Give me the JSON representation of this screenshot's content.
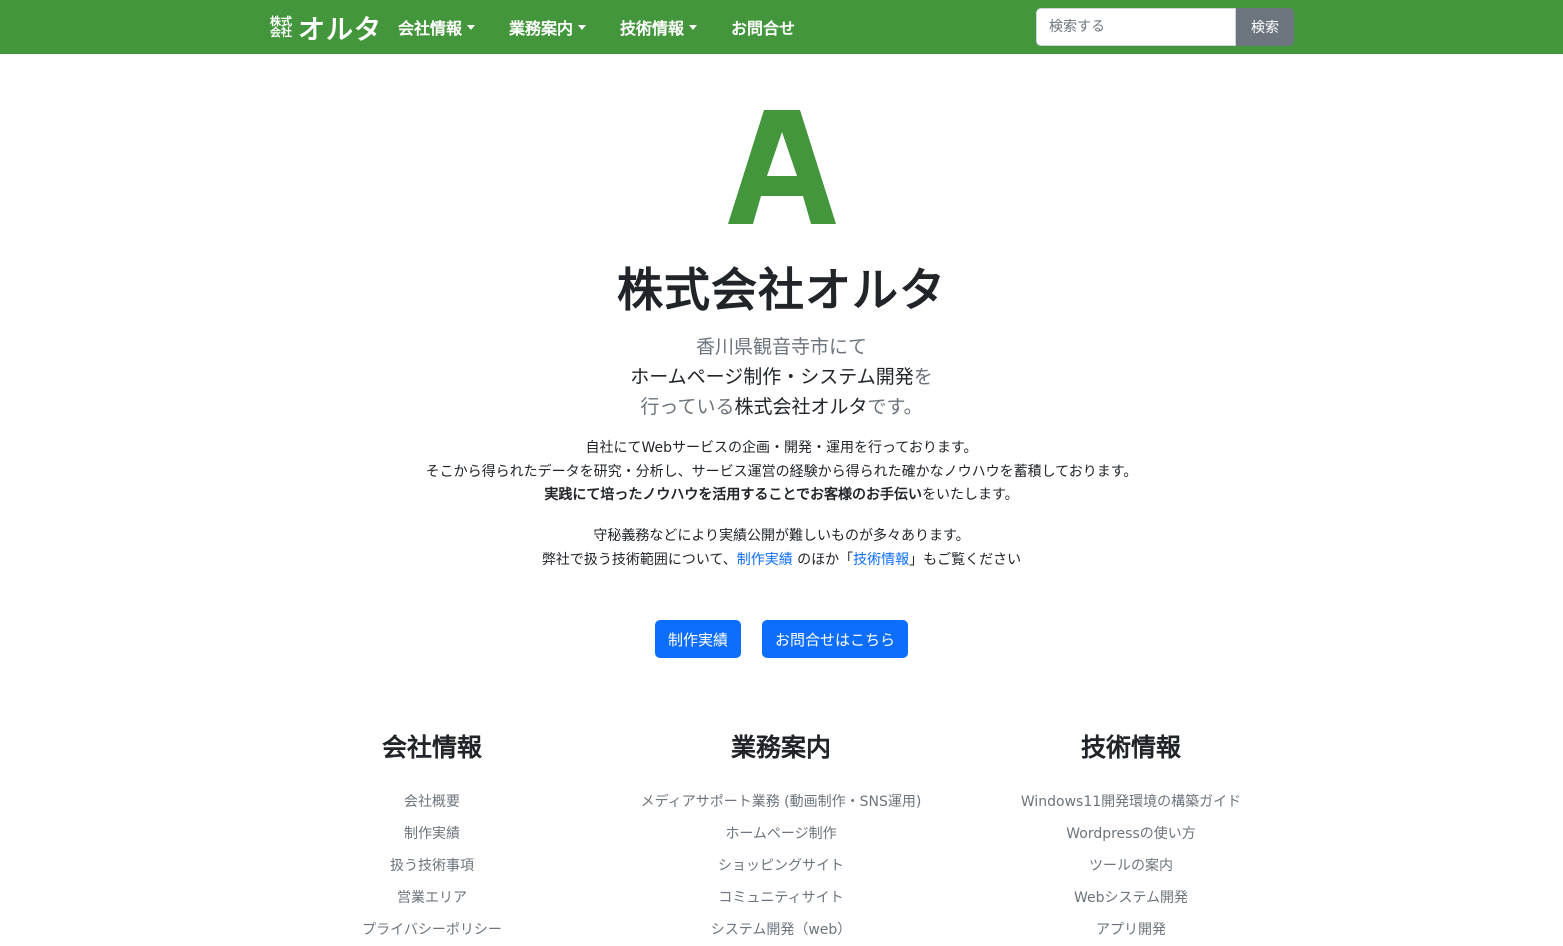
{
  "colors": {
    "navbar": "#43963b",
    "logo": "#43963b",
    "primary_button": "#0d6efd",
    "search_button": "#6c757d",
    "muted_text": "#6c757d"
  },
  "navbar": {
    "brand_small_top": "株式",
    "brand_small_bottom": "会社",
    "brand_main": "オルタ",
    "menu": [
      {
        "label": "会社情報"
      },
      {
        "label": "業務案内"
      },
      {
        "label": "技術情報"
      },
      {
        "label": "お問合せ"
      }
    ],
    "search": {
      "placeholder": "検索する",
      "value": "",
      "button_label": "検索"
    }
  },
  "hero": {
    "logo_letter": "A",
    "title": "株式会社オルタ",
    "lead_line1": "香川県観音寺市にて",
    "lead_line2_strong": "ホームページ制作・システム開発",
    "lead_line2_suffix": "を",
    "lead_line3_prefix": "行っている",
    "lead_line3_strong": "株式会社オルタ",
    "lead_line3_suffix": "です。",
    "desc_line1": "自社にてWebサービスの企画・開発・運用を行っております。",
    "desc_line2": "そこから得られたデータを研究・分析し、サービス運営の経験から得られた確かなノウハウを蓄積しております。",
    "desc_line3_strong": "実践にて培ったノウハウを活用することでお客様のお手伝い",
    "desc_line3_suffix": "をいたします。",
    "desc2_line1": "守秘義務などにより実績公開が難しいものが多々あります。",
    "desc2_line2_prefix": "弊社で扱う技術範囲について、",
    "desc2_link1": "制作実績",
    "desc2_mid1": " のほか「",
    "desc2_link2": "技術情報",
    "desc2_suffix": "」もご覧ください",
    "button_works": "制作実績",
    "button_contact": "お問合せはこちら"
  },
  "footer": {
    "columns": [
      {
        "heading": "会社情報",
        "items": [
          "会社概要",
          "制作実績",
          "扱う技術事項",
          "営業エリア",
          "プライバシーポリシー"
        ]
      },
      {
        "heading": "業務案内",
        "items": [
          "メディアサポート業務 (動画制作・SNS運用)",
          "ホームページ制作",
          "ショッピングサイト",
          "コミュニティサイト",
          "システム開発（web）"
        ]
      },
      {
        "heading": "技術情報",
        "items": [
          "Windows11開発環境の構築ガイド",
          "Wordpressの使い方",
          "ツールの案内",
          "Webシステム開発",
          "アプリ開発"
        ]
      }
    ]
  }
}
